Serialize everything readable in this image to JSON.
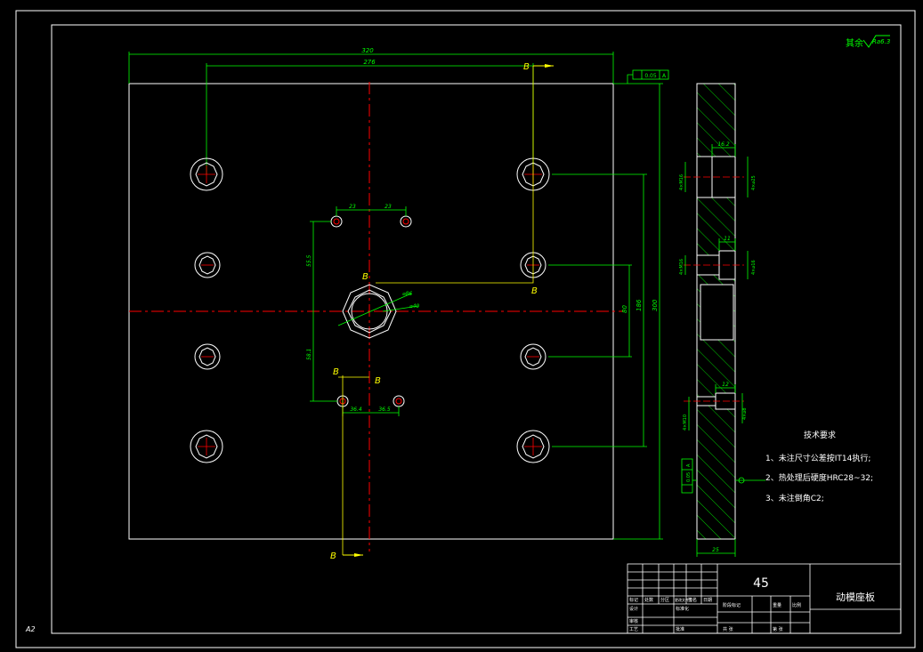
{
  "roughness_note": "其余",
  "roughness_value": "Ra6.3",
  "dims": {
    "overall_width": "320",
    "hole_span": "276",
    "side_height": "300",
    "small_hole_left_gap": "23",
    "small_hole_right_gap": "23",
    "upper_offset": "55.5",
    "lower_offset": "58.1",
    "bottom_left_gap": "36.4",
    "bottom_right_gap": "36.5",
    "inner_80": "80",
    "inner_186": "186",
    "side_thickness": "25",
    "counterbore_top_depth": "16.2",
    "counterbore_mid_depth": "11",
    "counterbore_low_depth": "12",
    "center_bore_outer": "⌀86",
    "center_bore_inner": "⌀40",
    "flatness_tol": "0.05",
    "datum_a": "A",
    "parallel_tol": "0.05",
    "bolt_left_top": "4×M16",
    "bolt_left_mid": "4×M16",
    "bolt_left_low": "4×M10",
    "bolt_right_top": "4×⌀25",
    "bolt_right_mid": "4×⌀16",
    "bolt_right_low": "4×⌀8"
  },
  "section_labels": {
    "b_top": "B",
    "b_center": "B",
    "b_center_right": "B",
    "b_low_a": "B",
    "b_low_b": "B",
    "b_bottom": "B"
  },
  "tech_requirements": {
    "heading": "技术要求",
    "items": [
      "1、未注尺寸公差按IT14执行;",
      "2、热处理后硬度HRC28~32;",
      "3、未注倒角C2;"
    ]
  },
  "title_block": {
    "material": "45",
    "part_name": "动模座板",
    "sheet_size": "A2",
    "row_labels": [
      "标记",
      "处数",
      "分区",
      "更改文件号",
      "签名",
      "日期"
    ],
    "designer": "设计",
    "standardization": "标准化",
    "stage_marks": "阶段标记",
    "weight": "重量",
    "scale": "比例",
    "checker": "审核",
    "process": "工艺",
    "approve": "批准",
    "sheets_total": "共  张",
    "sheet_no": "第  张"
  }
}
